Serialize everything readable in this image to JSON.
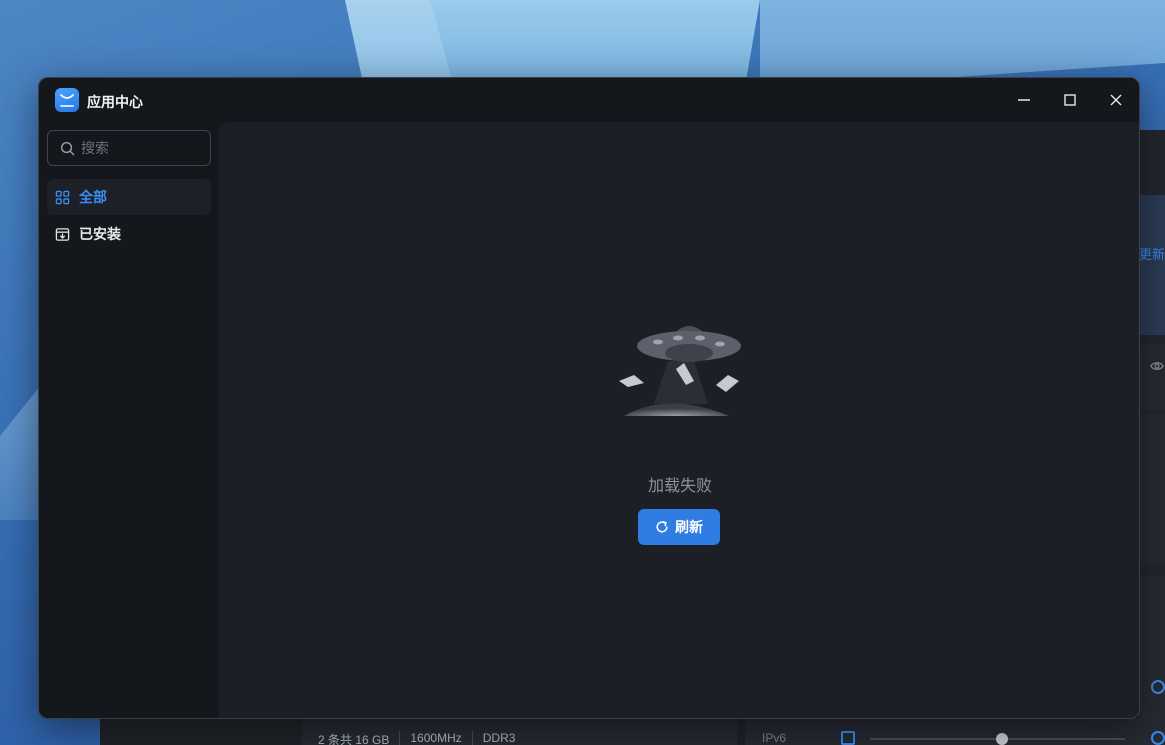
{
  "window": {
    "title": "应用中心",
    "controls": {
      "minimize": "minimize-icon",
      "maximize": "maximize-icon",
      "close": "close-icon"
    }
  },
  "sidebar": {
    "search": {
      "placeholder": "搜索",
      "value": ""
    },
    "items": [
      {
        "label": "全部",
        "icon": "grid-icon",
        "active": true
      },
      {
        "label": "已安装",
        "icon": "installed-box-icon",
        "active": false
      }
    ]
  },
  "main": {
    "error_message": "加载失败",
    "refresh_label": "刷新"
  },
  "background_window": {
    "update_label": "更新",
    "memory": {
      "slots": "2 条共 16 GB",
      "frequency": "1600MHz",
      "type": "DDR3"
    },
    "network": {
      "ipv6_label": "IPv6"
    }
  },
  "colors": {
    "accent": "#2f7ce3",
    "window_bg": "#14171b",
    "content_bg": "#1c1f25",
    "active_text": "#3d8ef2"
  }
}
